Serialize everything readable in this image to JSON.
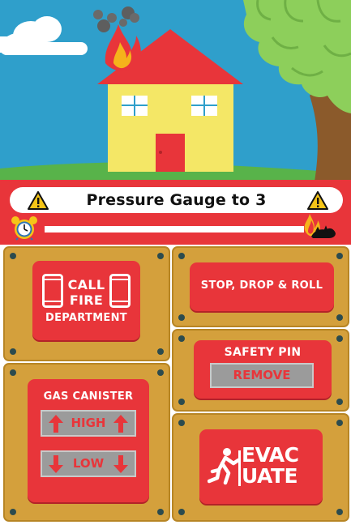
{
  "instruction": {
    "text": "Pressure Gauge to 3",
    "timer_remaining_fraction": 1.0
  },
  "controls": {
    "call_fire_department": {
      "line1": "CALL",
      "line2": "FIRE",
      "line3": "DEPARTMENT"
    },
    "stop_drop_roll": {
      "label": "STOP, DROP & ROLL"
    },
    "safety_pin": {
      "title": "SAFETY PIN",
      "button_label": "REMOVE"
    },
    "gas_canister": {
      "title": "GAS CANISTER",
      "high_label": "HIGH",
      "low_label": "LOW"
    },
    "evacuate": {
      "line1": "EVAC",
      "line2": "UATE"
    }
  },
  "colors": {
    "sky": "#2f9fcb",
    "grass": "#58b34a",
    "house_wall": "#f4e766",
    "roof": "#e8353a",
    "door": "#e8353a",
    "alert_red": "#e8353a",
    "wood": "#d4a03c",
    "button_gray": "#9b9b9b"
  },
  "icons": {
    "warning": "warning-triangle-icon",
    "clock": "alarm-clock-icon",
    "fire": "fire-icon",
    "phone": "phone-icon",
    "runner": "running-person-icon",
    "up": "arrow-up-icon",
    "down": "arrow-down-icon"
  }
}
